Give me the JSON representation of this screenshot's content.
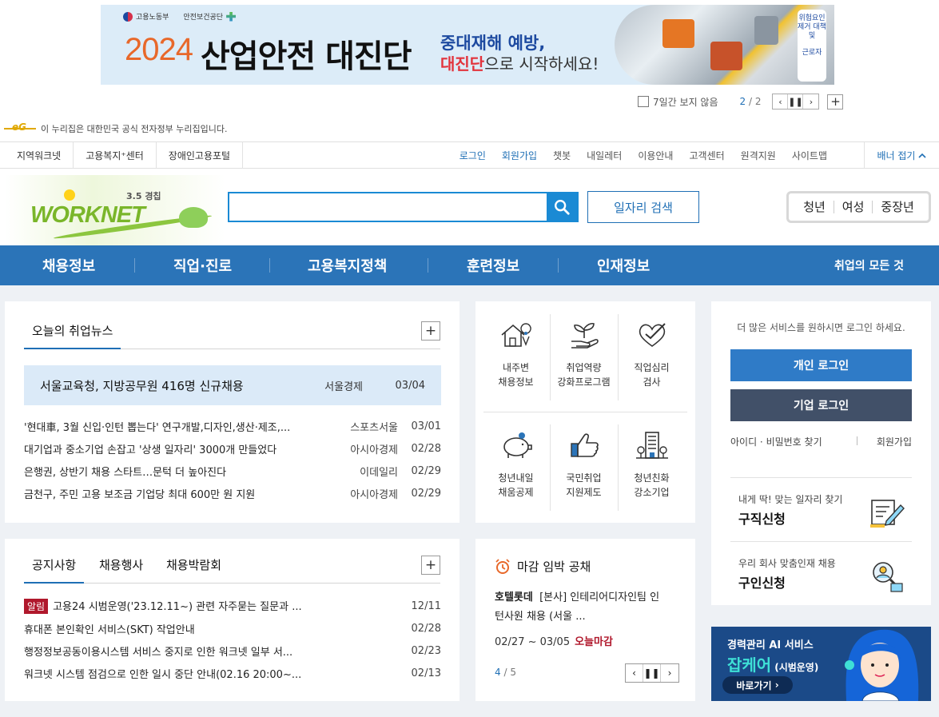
{
  "top_banner": {
    "logos": [
      "고용노동부",
      "안전보건공단"
    ],
    "year": "2024",
    "title": "산업안전 대진단",
    "sub1": "중대재해 예방,",
    "sub2_highlight": "대진단",
    "sub2_rest": "으로 시작하세요!",
    "side_sign": "위험요인 제거 대책 및",
    "side_sign2": "근로자",
    "hide_label": "7일간 보지 않음",
    "pager_current": "2",
    "pager_total": "/ 2"
  },
  "gov_notice": "이 누리집은 대한민국 공식 전자정부 누리집입니다.",
  "util_nav": {
    "left": [
      "지역워크넷",
      "고용복지⁺센터",
      "장애인고용포털"
    ],
    "right": [
      "로그인",
      "회원가입",
      "챗봇",
      "내일레터",
      "이용안내",
      "고객센터",
      "원격지원",
      "사이트맵"
    ],
    "fold": "배너 접기"
  },
  "header": {
    "logo_text": "WORKNET",
    "logo_version": "3.5 경칩",
    "search_placeholder": "",
    "job_search": "일자리 검색",
    "segments": [
      "청년",
      "여성",
      "중장년"
    ]
  },
  "gnb": {
    "items": [
      "채용정보",
      "직업·진로",
      "고용복지정책",
      "훈련정보",
      "인재정보"
    ],
    "all": "취업의 모든 것"
  },
  "news": {
    "tab": "오늘의 취업뉴스",
    "headline": {
      "title": "서울교육청, 지방공무원 416명 신규채용",
      "source": "서울경제",
      "date": "03/04"
    },
    "items": [
      {
        "title": "'현대車, 3월 신입·인턴 뽑는다' 연구개발,디자인,생산·제조,...",
        "source": "스포츠서울",
        "date": "03/01"
      },
      {
        "title": "대기업과 중소기업 손잡고 '상생 일자리' 3000개 만들었다",
        "source": "아시아경제",
        "date": "02/28"
      },
      {
        "title": "은행권, 상반기 채용 스타트…문턱 더 높아진다",
        "source": "이데일리",
        "date": "02/29"
      },
      {
        "title": "금천구, 주민 고용 보조금 기업당 최대 600만 원 지원",
        "source": "아시아경제",
        "date": "02/29"
      }
    ]
  },
  "services": [
    {
      "line1": "내주변",
      "line2": "채용정보",
      "icon": "house-map-pin-icon"
    },
    {
      "line1": "취업역량",
      "line2": "강화프로그램",
      "icon": "sprout-hand-icon"
    },
    {
      "line1": "직업심리",
      "line2": "검사",
      "icon": "heart-check-icon"
    },
    {
      "line1": "청년내일",
      "line2": "채움공제",
      "icon": "piggy-bank-icon"
    },
    {
      "line1": "국민취업",
      "line2": "지원제도",
      "icon": "thumbs-up-icon"
    },
    {
      "line1": "청년친화",
      "line2": "강소기업",
      "icon": "building-icon"
    }
  ],
  "login": {
    "message": "더 많은 서비스를 원하시면 로그인 하세요.",
    "personal": "개인 로그인",
    "company": "기업 로그인",
    "find": "아이디 · 비밀번호 찾기",
    "join": "회원가입",
    "cta1_small": "내게 딱! 맞는 일자리 찾기",
    "cta1_big": "구직신청",
    "cta2_small": "우리 회사 맞춤인재 채용",
    "cta2_big": "구인신청"
  },
  "notice": {
    "tabs": [
      "공지사항",
      "채용행사",
      "채용박람회"
    ],
    "items": [
      {
        "badge": "알림",
        "title": "고용24 시범운영('23.12.11~) 관련 자주묻는 질문과 ...",
        "date": "12/11"
      },
      {
        "badge": "",
        "title": "휴대폰 본인확인 서비스(SKT) 작업안내",
        "date": "02/28"
      },
      {
        "badge": "",
        "title": "행정정보공동이용시스템 서비스 중지로 인한 워크넷 일부 서...",
        "date": "02/23"
      },
      {
        "badge": "",
        "title": "워크넷 시스템 점검으로 인한 일시 중단 안내(02.16 20:00~...",
        "date": "02/13"
      }
    ]
  },
  "deadline": {
    "title": "마감 임박 공채",
    "company": "호텔롯데",
    "text": "[본사] 인테리어디자인팀 인턴사원 채용 (서울 ...",
    "text_line1": "[본사] 인테리어디자인팀 인",
    "text_line2": "턴사원 채용 (서울 ...",
    "period": "02/27 ~ 03/05",
    "status": "오늘마감",
    "page": "4",
    "total": "/ 5"
  },
  "ai_banner": {
    "line1": "경력관리 AI 서비스",
    "line2": "잡케어",
    "line2_sub": "(시범운영)",
    "go": "바로가기"
  },
  "colors": {
    "gnb": "#2b74b8",
    "accent": "#1f6fb5",
    "alert": "#b0182c",
    "headline_bg": "#dbeaf8",
    "dark_button": "#415068"
  }
}
